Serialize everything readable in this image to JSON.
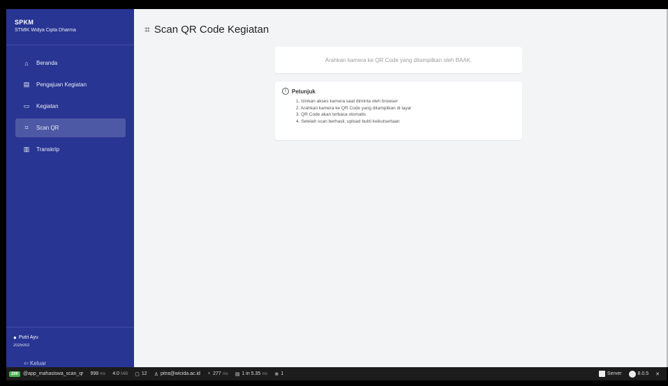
{
  "sidebar": {
    "brand_title": "SPKM",
    "brand_sub": "STMIK Widya Cipta Dharma",
    "items": [
      {
        "label": "Beranda",
        "icon": "home-icon",
        "glyph": "⌂"
      },
      {
        "label": "Pengajuan Kegiatan",
        "icon": "document-icon",
        "glyph": "▤"
      },
      {
        "label": "Kegiatan",
        "icon": "calendar-icon",
        "glyph": "▭"
      },
      {
        "label": "Scan QR",
        "icon": "qr-icon",
        "glyph": "⌗",
        "active": true
      },
      {
        "label": "Transkrip",
        "icon": "transcript-icon",
        "glyph": "▥"
      }
    ],
    "user": {
      "name": "Putri Ayu",
      "id": "2025002"
    },
    "logout_label": "Keluar"
  },
  "main": {
    "title": "Scan QR Code Kegiatan",
    "camera_hint": "Arahkan kamera ke QR Code yang ditampilkan oleh BAAK.",
    "tips_title": "Petunjuk",
    "tips": [
      "1. Izinkan akses kamera saat diminta oleh browser",
      "2. Arahkan kamera ke QR Code yang ditampilkan di layar",
      "3. QR Code akan terbaca otomatis",
      "4. Setelah scan berhasil, upload bukti keikutsertaan"
    ]
  },
  "statusbar": {
    "status_code": "200",
    "route": "app_mahasiswa_scan_qr",
    "time": "998",
    "time_unit": "ms",
    "memory": "4.0",
    "memory_unit": "MiB",
    "files": "12",
    "user_email": "pitra@wicida.ac.id",
    "twig": "277",
    "twig_unit": "ms",
    "db": "1 in 5.35",
    "db_unit": "ms",
    "cache": "1",
    "server_label": "Server",
    "version": "8.0.5"
  }
}
